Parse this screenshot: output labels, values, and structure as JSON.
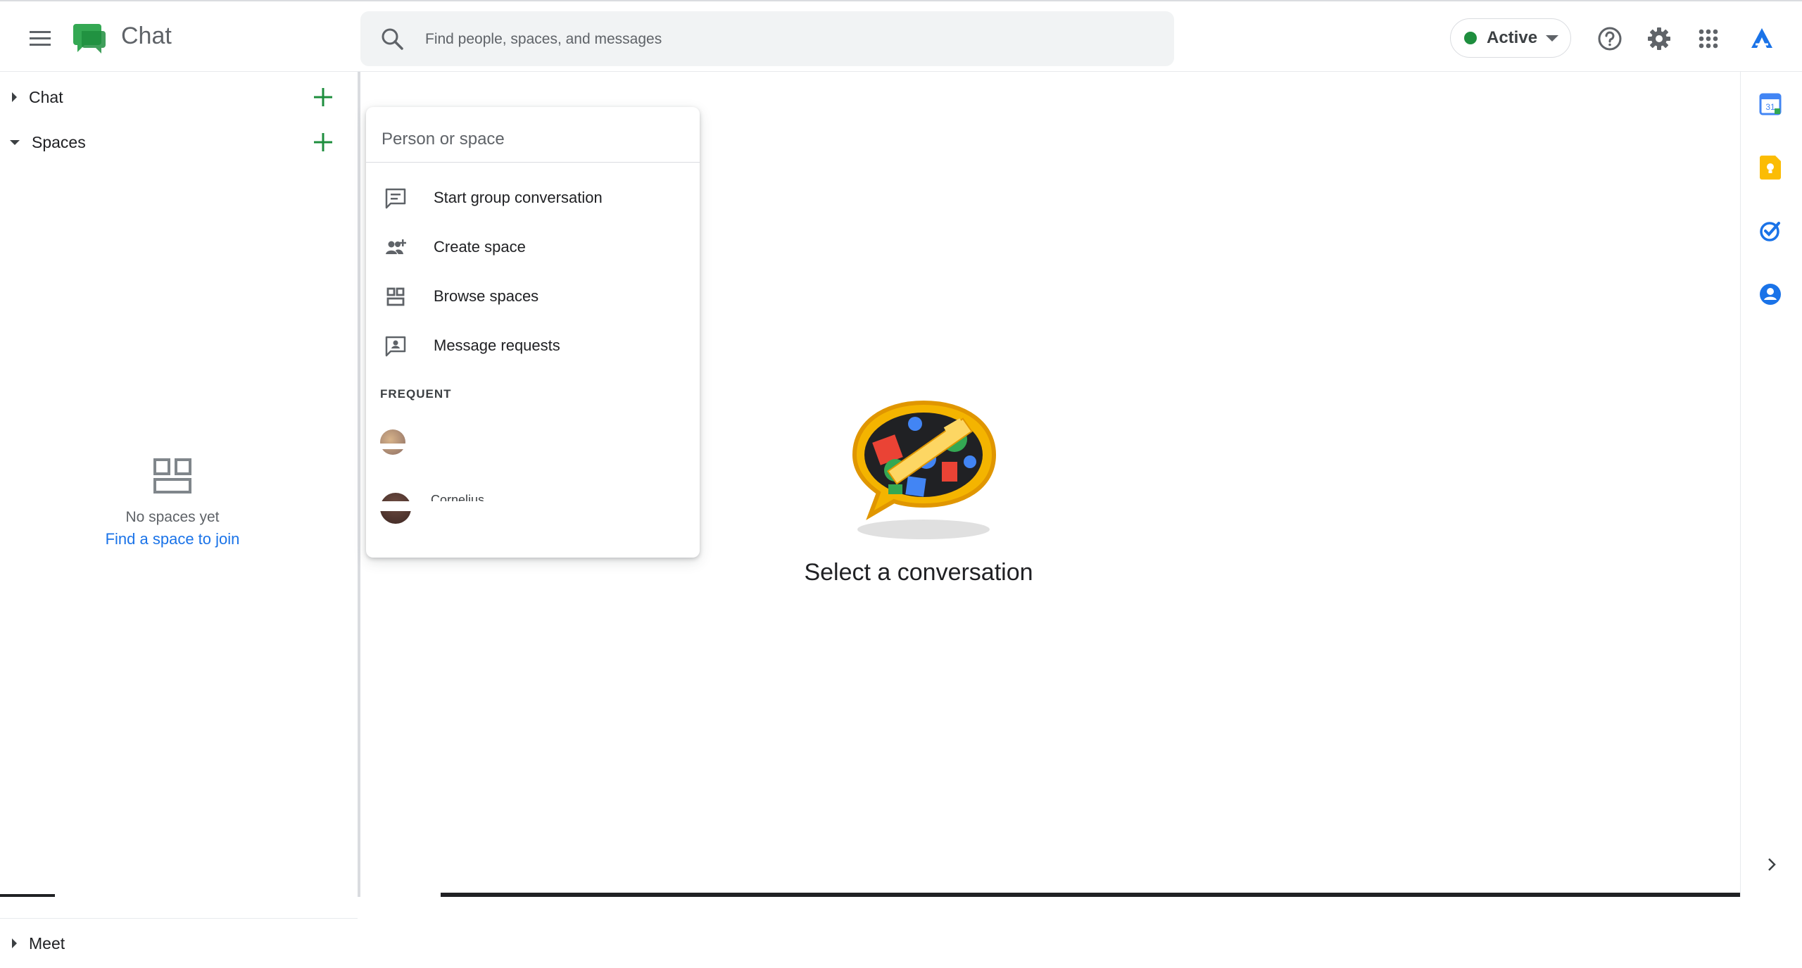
{
  "app": {
    "title": "Chat"
  },
  "search": {
    "placeholder": "Find people, spaces, and messages"
  },
  "status": {
    "label": "Active",
    "color": "#1e8e3e"
  },
  "header_icons": [
    "help-icon",
    "settings-icon",
    "apps-grid-icon",
    "account-icon"
  ],
  "sidebar": {
    "chat_label": "Chat",
    "spaces_label": "Spaces",
    "meet_label": "Meet",
    "empty_text": "No spaces yet",
    "empty_link": "Find a space to join"
  },
  "main": {
    "title": "Select a conversation"
  },
  "popup": {
    "input_placeholder": "Person or space",
    "items": [
      {
        "label": "Start group conversation",
        "icon": "group-chat-icon"
      },
      {
        "label": "Create space",
        "icon": "create-space-icon"
      },
      {
        "label": "Browse spaces",
        "icon": "browse-spaces-icon"
      },
      {
        "label": "Message requests",
        "icon": "message-requests-icon"
      }
    ],
    "frequent_heading": "FREQUENT",
    "frequent": [
      {
        "name": ""
      },
      {
        "name": "Cornelius"
      }
    ]
  },
  "right_rail": {
    "icons": [
      "calendar-icon",
      "keep-icon",
      "tasks-icon",
      "contacts-icon"
    ],
    "calendar_day": "31"
  },
  "colors": {
    "accent_green": "#1e8e3e",
    "link_blue": "#1a73e8",
    "keep_yellow": "#fbbc04"
  }
}
